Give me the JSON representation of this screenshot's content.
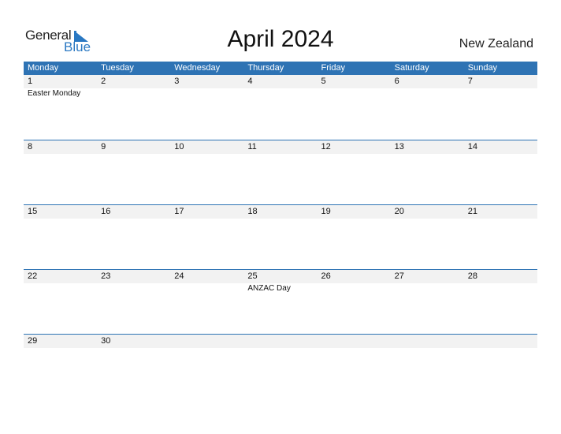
{
  "logo": {
    "word1": "General",
    "word2": "Blue",
    "accent": "#2a78c2"
  },
  "header": {
    "title": "April 2024",
    "country": "New Zealand"
  },
  "colors": {
    "header_bg": "#2e73b4",
    "strip_bg": "#f2f2f2"
  },
  "weekdays": [
    "Monday",
    "Tuesday",
    "Wednesday",
    "Thursday",
    "Friday",
    "Saturday",
    "Sunday"
  ],
  "weeks": [
    {
      "days": [
        "1",
        "2",
        "3",
        "4",
        "5",
        "6",
        "7"
      ],
      "events": [
        "Easter Monday",
        "",
        "",
        "",
        "",
        "",
        ""
      ]
    },
    {
      "days": [
        "8",
        "9",
        "10",
        "11",
        "12",
        "13",
        "14"
      ],
      "events": [
        "",
        "",
        "",
        "",
        "",
        "",
        ""
      ]
    },
    {
      "days": [
        "15",
        "16",
        "17",
        "18",
        "19",
        "20",
        "21"
      ],
      "events": [
        "",
        "",
        "",
        "",
        "",
        "",
        ""
      ]
    },
    {
      "days": [
        "22",
        "23",
        "24",
        "25",
        "26",
        "27",
        "28"
      ],
      "events": [
        "",
        "",
        "",
        "ANZAC Day",
        "",
        "",
        ""
      ]
    },
    {
      "days": [
        "29",
        "30",
        "",
        "",
        "",
        "",
        ""
      ],
      "events": [
        "",
        "",
        "",
        "",
        "",
        "",
        ""
      ]
    }
  ]
}
